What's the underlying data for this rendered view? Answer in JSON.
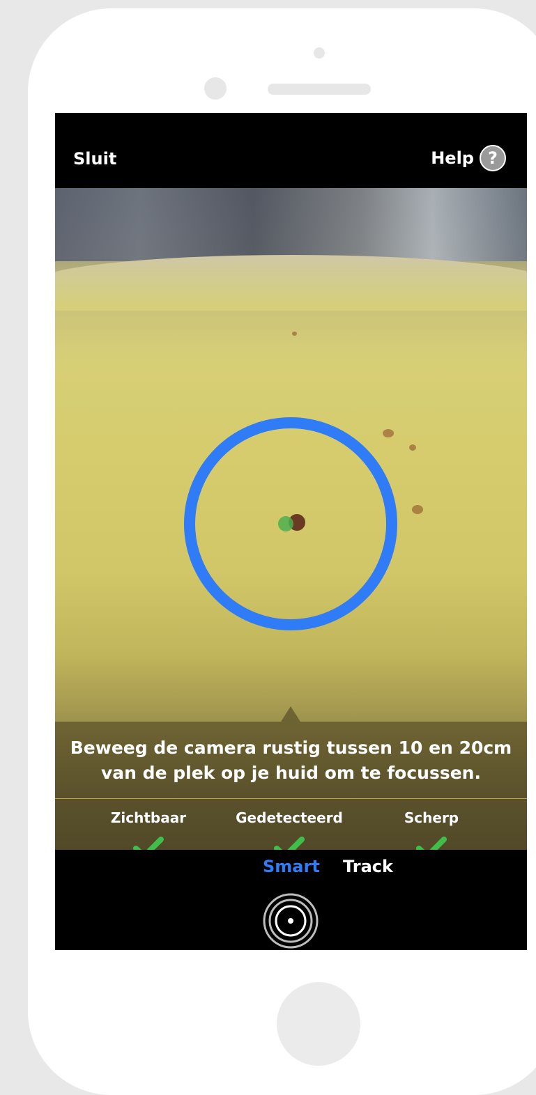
{
  "header": {
    "close_label": "Sluit",
    "help_label": "Help",
    "help_icon_glyph": "?"
  },
  "camera": {
    "instruction": "Beweeg de camera rustig tussen 10 en 20cm van de plek op je huid om te focussen.",
    "checks": [
      {
        "label": "Zichtbaar",
        "status": "check-icon"
      },
      {
        "label": "Gedetecteerd",
        "status": "check-icon"
      },
      {
        "label": "Scherp",
        "status": "check-icon"
      }
    ],
    "colors": {
      "ring": "#2f7cf6",
      "check": "#3fbf4a",
      "target_dot": "#4caf50"
    }
  },
  "modes": {
    "active": "Smart",
    "inactive": "Track"
  }
}
